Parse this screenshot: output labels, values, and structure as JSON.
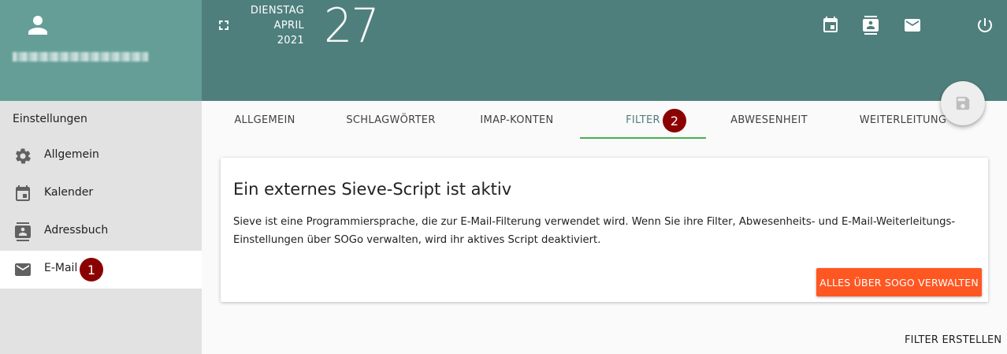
{
  "date": {
    "weekday": "DIENSTAG",
    "month": "APRIL",
    "year": "2021",
    "day": "27"
  },
  "sidebar": {
    "title": "Einstellungen",
    "items": [
      {
        "label": "Allgemein",
        "icon": "gear-icon"
      },
      {
        "label": "Kalender",
        "icon": "calendar-icon"
      },
      {
        "label": "Adressbuch",
        "icon": "contacts-icon"
      },
      {
        "label": "E-Mail",
        "icon": "mail-icon",
        "active": true,
        "badge": "1"
      }
    ]
  },
  "topbar": {
    "icons": [
      "fullscreen-icon",
      "calendar-icon",
      "contacts-icon",
      "mail-icon",
      "power-icon"
    ]
  },
  "tabs": [
    {
      "label": "ALLGEMEIN"
    },
    {
      "label": "SCHLAGWÖRTER"
    },
    {
      "label": "IMAP-KONTEN"
    },
    {
      "label": "FILTER",
      "active": true,
      "badge": "2"
    },
    {
      "label": "ABWESENHEIT"
    },
    {
      "label": "WEITERLEITUNG"
    }
  ],
  "card": {
    "title": "Ein externes Sieve-Script ist aktiv",
    "text": "Sieve ist eine Programmiersprache, die zur E-Mail-Filterung verwendet wird. Wenn Sie ihre Filter, Abwesenheits- und E-Mail-Weiterleitungs-Einstellungen über SOGo verwalten, wird ihr aktives Script deaktiviert.",
    "button": "ALLES ÜBER SOGO VERWALTEN"
  },
  "create_filter": "FILTER ERSTELLEN",
  "colors": {
    "header": "#4e7f7c",
    "user_panel": "#649e97",
    "accent_button": "#ff5722",
    "tab_indicator": "#4caf50",
    "badge": "#8b0000"
  }
}
